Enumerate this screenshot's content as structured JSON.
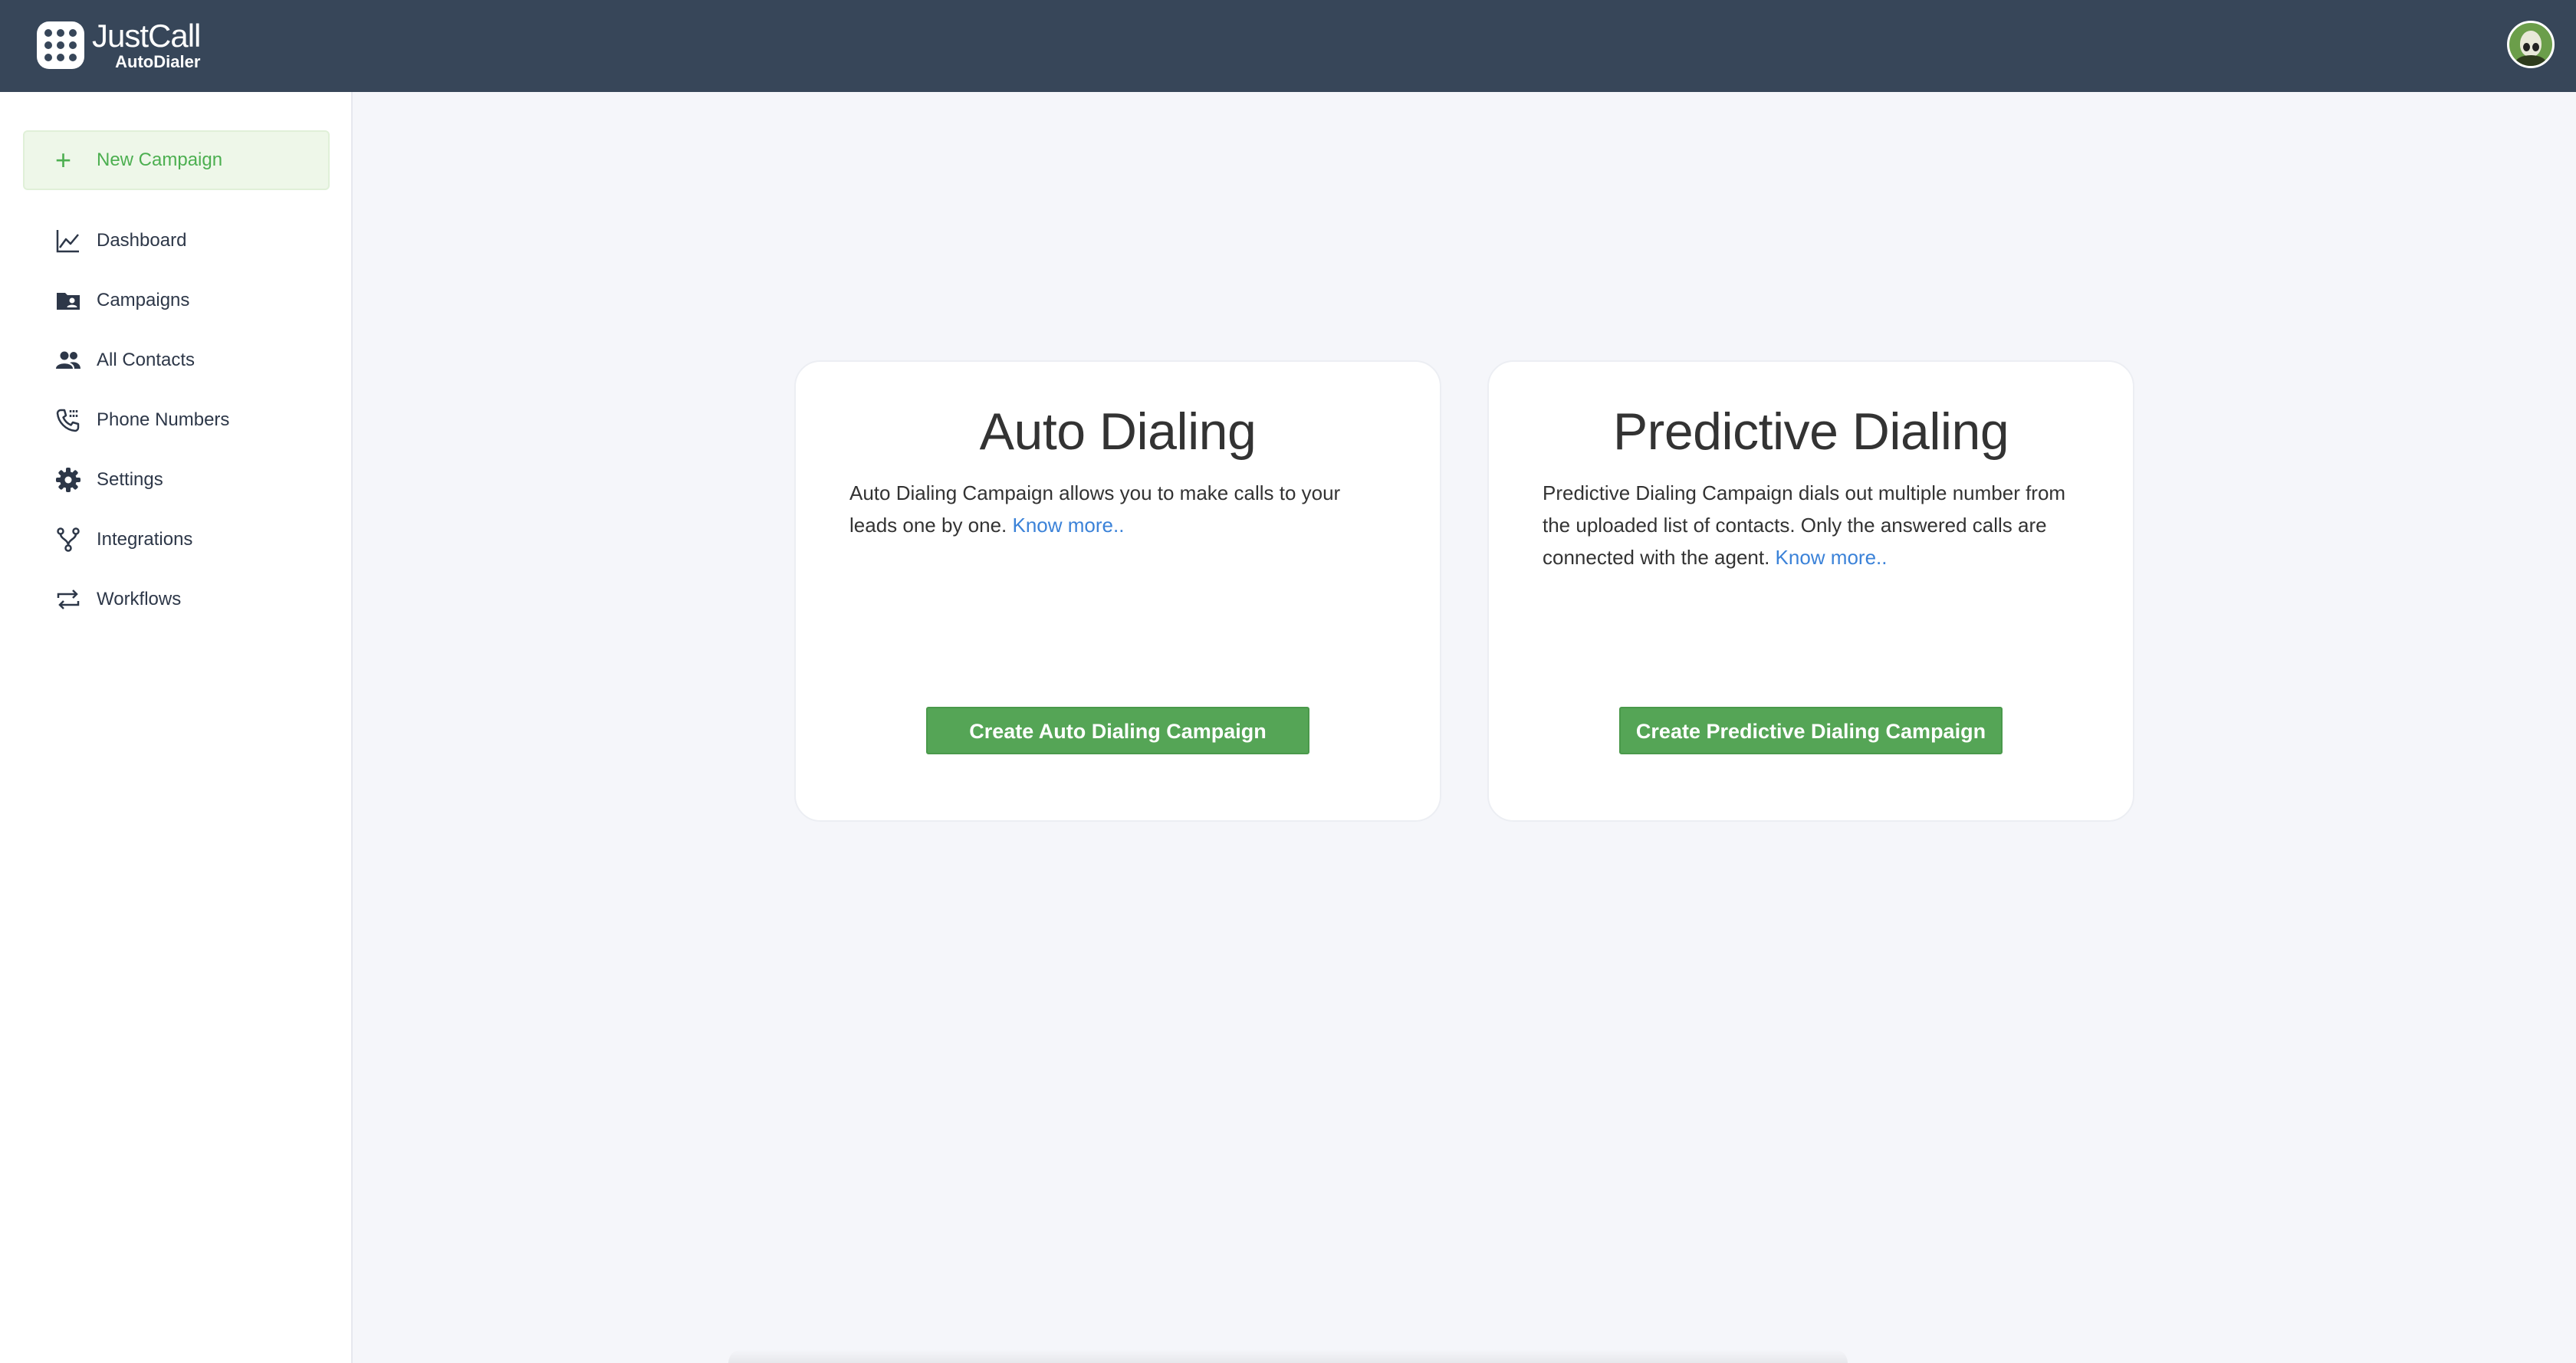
{
  "app": {
    "brand_title": "JustCall",
    "brand_subtitle": "AutoDialer"
  },
  "sidebar": {
    "new_campaign_label": "New Campaign",
    "items": [
      {
        "label": "Dashboard",
        "icon": "chart-line-icon"
      },
      {
        "label": "Campaigns",
        "icon": "folder-contact-icon"
      },
      {
        "label": "All Contacts",
        "icon": "people-icon"
      },
      {
        "label": "Phone Numbers",
        "icon": "phone-icon"
      },
      {
        "label": "Settings",
        "icon": "gear-icon"
      },
      {
        "label": "Integrations",
        "icon": "fork-icon"
      },
      {
        "label": "Workflows",
        "icon": "repeat-icon"
      }
    ]
  },
  "cards": {
    "auto": {
      "title": "Auto Dialing",
      "description": "Auto Dialing Campaign allows you to make calls to your leads one by one. ",
      "link": "Know more..",
      "button": "Create Auto Dialing Campaign"
    },
    "predictive": {
      "title": "Predictive Dialing",
      "description": "Predictive Dialing Campaign dials out multiple number from the uploaded list of contacts. Only the answered calls are connected with the agent. ",
      "link": "Know more..",
      "button": "Create Predictive Dialing Campaign"
    }
  },
  "colors": {
    "topbar": "#374659",
    "accent_green": "#55a556",
    "link_blue": "#3b82d8",
    "background": "#f5f6fa"
  }
}
